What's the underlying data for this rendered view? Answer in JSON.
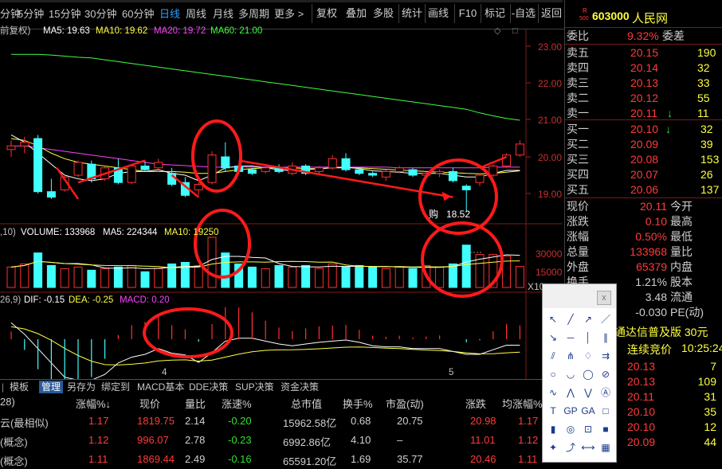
{
  "toolbar": {
    "tabs": [
      "分钟",
      "5分钟",
      "15分钟",
      "30分钟",
      "60分钟",
      "日线",
      "周线",
      "月线",
      "多周期",
      "更多"
    ],
    "active_tab": "日线",
    "buttons": [
      "复权",
      "叠加",
      "多股",
      "统计",
      "画线",
      "F10",
      "标记",
      "-自选",
      "返回"
    ]
  },
  "chart": {
    "indicator_prefix": "前复权)",
    "ma_labels": {
      "ma5": "MA5: 19.63",
      "ma10": "MA10: 19.62",
      "ma20": "MA20: 19.72",
      "ma60": "MA60: 21.00"
    },
    "price_axis": [
      "23.00",
      "22.00",
      "21.00",
      "20.00",
      "19.00"
    ],
    "low_marker": "18.52",
    "low_prefix": "购",
    "volume_header": {
      "prefix": ",10)",
      "vol": "VOLUME: 133968",
      "ma5": "MA5: 224344",
      "ma10": "MA10: 19250"
    },
    "volume_axis": [
      "30000",
      "15000",
      "X10"
    ],
    "macd_header": {
      "prefix": "26,9)",
      "dif": "DIF: -0.15",
      "dea": "DEA: -0.25",
      "macd": "MACD: 0.20"
    },
    "months": [
      "4",
      "5"
    ],
    "colors": {
      "up": "#ff3030",
      "down": "#40ffff",
      "ma5": "#ffffff",
      "ma10": "#ffff40",
      "ma20": "#ff40ff",
      "ma60": "#40ff40",
      "circle": "#ff1a1a"
    },
    "chart_data": {
      "type": "candlestick",
      "ohlc": [
        [
          20.2,
          20.45,
          20.0,
          20.3
        ],
        [
          20.3,
          20.55,
          20.1,
          20.4
        ],
        [
          20.5,
          20.6,
          19.0,
          19.05
        ],
        [
          19.05,
          19.4,
          18.85,
          18.9
        ],
        [
          19.1,
          19.5,
          19.05,
          19.45
        ],
        [
          19.5,
          19.9,
          19.45,
          19.85
        ],
        [
          19.8,
          19.9,
          19.3,
          19.4
        ],
        [
          19.4,
          19.75,
          19.35,
          19.7
        ],
        [
          19.7,
          19.95,
          19.25,
          19.3
        ],
        [
          19.3,
          19.8,
          19.25,
          19.75
        ],
        [
          19.75,
          19.9,
          19.6,
          19.65
        ],
        [
          19.7,
          19.95,
          19.65,
          19.85
        ],
        [
          19.55,
          19.7,
          19.2,
          19.25
        ],
        [
          19.3,
          19.45,
          18.9,
          18.95
        ],
        [
          19.1,
          19.3,
          18.95,
          19.25
        ],
        [
          19.3,
          20.15,
          19.25,
          20.05
        ],
        [
          20.0,
          20.4,
          19.6,
          19.7
        ],
        [
          19.75,
          19.8,
          19.55,
          19.6
        ],
        [
          19.65,
          19.7,
          19.5,
          19.55
        ],
        [
          19.6,
          19.75,
          19.55,
          19.7
        ],
        [
          19.7,
          19.8,
          19.55,
          19.6
        ],
        [
          19.55,
          19.85,
          19.5,
          19.75
        ],
        [
          19.75,
          19.8,
          19.5,
          19.55
        ],
        [
          19.6,
          19.75,
          19.55,
          19.7
        ],
        [
          19.7,
          20.05,
          19.65,
          19.95
        ],
        [
          19.95,
          20.1,
          19.6,
          19.65
        ],
        [
          19.65,
          19.7,
          19.5,
          19.55
        ],
        [
          19.55,
          19.6,
          19.45,
          19.5
        ],
        [
          19.45,
          19.65,
          19.35,
          19.6
        ],
        [
          19.6,
          19.75,
          19.55,
          19.7
        ],
        [
          19.65,
          19.7,
          19.45,
          19.5
        ],
        [
          19.5,
          19.6,
          19.4,
          19.55
        ],
        [
          19.55,
          19.65,
          19.45,
          19.6
        ],
        [
          19.6,
          19.7,
          19.3,
          19.35
        ],
        [
          19.2,
          19.25,
          18.52,
          19.1
        ],
        [
          19.3,
          19.55,
          19.2,
          19.5
        ],
        [
          19.5,
          19.8,
          19.45,
          19.75
        ],
        [
          19.75,
          20.1,
          19.7,
          20.05
        ],
        [
          20.05,
          20.45,
          20.0,
          20.35
        ]
      ],
      "volume": [
        130000,
        150000,
        220000,
        140000,
        120000,
        130000,
        110000,
        120000,
        130000,
        140000,
        100000,
        120000,
        150000,
        160000,
        140000,
        320000,
        220000,
        150000,
        130000,
        120000,
        140000,
        130000,
        140000,
        120000,
        150000,
        130000,
        140000,
        130000,
        120000,
        130000,
        120000,
        140000,
        130000,
        150000,
        270000,
        210000,
        210000,
        200000,
        133968
      ],
      "ma5": [
        20.6,
        20.4,
        20.1,
        19.8,
        19.5,
        19.4,
        19.35,
        19.4,
        19.55,
        19.6,
        19.6,
        19.65,
        19.55,
        19.5,
        19.35,
        19.5,
        19.7,
        19.75,
        19.75,
        19.7,
        19.65,
        19.62,
        19.65,
        19.68,
        19.7,
        19.72,
        19.68,
        19.62,
        19.6,
        19.58,
        19.55,
        19.55,
        19.55,
        19.5,
        19.45,
        19.45,
        19.55,
        19.63,
        19.63
      ],
      "ma10": [
        20.5,
        20.45,
        20.3,
        20.1,
        19.95,
        19.85,
        19.8,
        19.75,
        19.7,
        19.65,
        19.6,
        19.6,
        19.6,
        19.58,
        19.55,
        19.55,
        19.6,
        19.65,
        19.68,
        19.7,
        19.7,
        19.7,
        19.68,
        19.68,
        19.7,
        19.7,
        19.7,
        19.68,
        19.66,
        19.64,
        19.62,
        19.6,
        19.58,
        19.57,
        19.55,
        19.54,
        19.55,
        19.58,
        19.62
      ],
      "ma20": [
        20.3,
        20.3,
        20.25,
        20.2,
        20.15,
        20.1,
        20.05,
        20.0,
        19.95,
        19.9,
        19.85,
        19.8,
        19.78,
        19.76,
        19.74,
        19.72,
        19.72,
        19.72,
        19.72,
        19.72,
        19.72,
        19.72,
        19.72,
        19.72,
        19.72,
        19.72,
        19.72,
        19.72,
        19.72,
        19.7,
        19.7,
        19.7,
        19.7,
        19.7,
        19.7,
        19.7,
        19.72,
        19.72,
        19.72
      ],
      "ma60": [
        22.8,
        22.8,
        22.8,
        22.78,
        22.75,
        22.72,
        22.7,
        22.65,
        22.6,
        22.55,
        22.5,
        22.45,
        22.4,
        22.35,
        22.3,
        22.25,
        22.2,
        22.15,
        22.1,
        22.05,
        22.0,
        21.95,
        21.9,
        21.85,
        21.8,
        21.75,
        21.7,
        21.65,
        21.6,
        21.55,
        21.5,
        21.45,
        21.4,
        21.35,
        21.3,
        21.2,
        21.12,
        21.05,
        21.0
      ]
    }
  },
  "bottom_tabs": [
    "模板",
    "管理",
    "另存为",
    "绑定到",
    "MACD基本",
    "DDE决策",
    "SUP决策",
    "资金决策"
  ],
  "bottom_tabs_prefix": "|",
  "active_bottom_tab": "管理",
  "table": {
    "headers": [
      "28)",
      "涨幅%↓",
      "现价",
      "量比",
      "涨速%",
      "总市值",
      "换手%",
      "市盈(动)",
      "涨跌",
      "均涨幅%"
    ],
    "rows": [
      [
        "云(最相似)",
        "1.17",
        "1819.75",
        "2.14",
        "-0.20",
        "15962.58亿",
        "0.68",
        "20.75",
        "20.98",
        "1.17"
      ],
      [
        "(概念)",
        "1.12",
        "996.07",
        "2.78",
        "-0.23",
        "6992.86亿",
        "4.10",
        "–",
        "11.01",
        "1.12"
      ],
      [
        "(概念)",
        "1.11",
        "1869.44",
        "2.49",
        "-0.16",
        "65591.20亿",
        "1.69",
        "35.77",
        "20.46",
        "1.11"
      ]
    ]
  },
  "quote": {
    "code": "603000",
    "name": "人民网",
    "r_label": "R",
    "r_sub": "500",
    "webi_label": "委比",
    "webi_val": "9.32%",
    "weicha_label": "委差",
    "sells": [
      [
        "卖五",
        "20.15",
        "190"
      ],
      [
        "卖四",
        "20.14",
        "32"
      ],
      [
        "卖三",
        "20.13",
        "33"
      ],
      [
        "卖二",
        "20.12",
        "55"
      ],
      [
        "卖一",
        "20.11",
        "11"
      ]
    ],
    "buys": [
      [
        "买一",
        "20.10",
        "32"
      ],
      [
        "买二",
        "20.09",
        "39"
      ],
      [
        "买三",
        "20.08",
        "153"
      ],
      [
        "买四",
        "20.07",
        "26"
      ],
      [
        "买五",
        "20.06",
        "137"
      ]
    ],
    "stats": [
      [
        "现价",
        "20.11",
        "今开",
        ""
      ],
      [
        "涨跌",
        "0.10",
        "最高",
        ""
      ],
      [
        "涨幅",
        "0.50%",
        "最低",
        ""
      ],
      [
        "总量",
        "133968",
        "量比",
        ""
      ],
      [
        "外盘",
        "65379",
        "内盘",
        ""
      ],
      [
        "换手",
        "1.21%",
        "股本",
        ""
      ],
      [
        "",
        "3.48",
        "流通",
        ""
      ],
      [
        "",
        "-0.030",
        "PE(动)",
        ""
      ]
    ],
    "banner": "通达信普及版 30元",
    "auction_label": "连续竞价",
    "auction_time": "10:25:24",
    "ticks": [
      [
        "20.13",
        "7"
      ],
      [
        "20.13",
        "109"
      ],
      [
        "20.11",
        "31"
      ],
      [
        "20.10",
        "35"
      ],
      [
        "20.10",
        "12"
      ],
      [
        "20.09",
        "44"
      ]
    ]
  },
  "toolbox": {
    "icons": [
      "cursor-icon",
      "line-icon",
      "ray-icon",
      "segment-icon",
      "arrow-icon",
      "hline-icon",
      "vline-icon",
      "parallel-icon",
      "fib-icon",
      "fan-icon",
      "gann-icon",
      "channel-icon",
      "circle-icon",
      "arc-icon",
      "ellipse-icon",
      "forbid-icon",
      "wave-icon",
      "zigzag-icon",
      "elliott-icon",
      "abc-icon",
      "text-icon",
      "gp-icon",
      "ga-icon",
      "box-icon",
      "bar-icon",
      "cycle-icon",
      "period-icon",
      "square-icon",
      "mark-icon",
      "trend-icon",
      "range-icon",
      "grid-icon"
    ],
    "close": "x"
  }
}
